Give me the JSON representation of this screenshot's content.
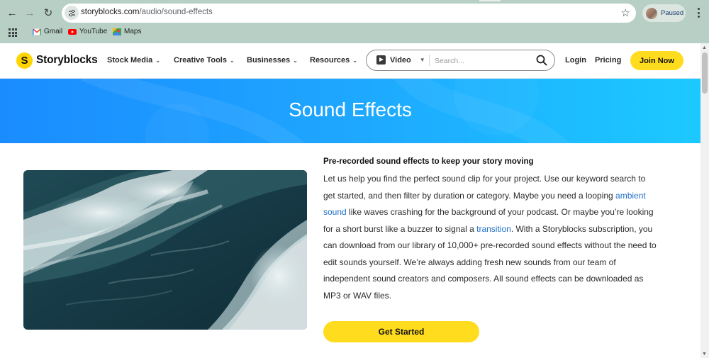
{
  "browser": {
    "url_host": "storyblocks.com",
    "url_path": "/audio/sound-effects",
    "profile_status": "Paused",
    "bookmarks": [
      {
        "label": "Gmail",
        "icon": "gmail-icon"
      },
      {
        "label": "YouTube",
        "icon": "youtube-icon"
      },
      {
        "label": "Maps",
        "icon": "maps-icon"
      }
    ]
  },
  "header": {
    "logo_mark": "S",
    "logo_text": "Storyblocks",
    "nav": [
      {
        "label": "Stock Media"
      },
      {
        "label": "Creative Tools"
      },
      {
        "label": "Businesses"
      },
      {
        "label": "Resources"
      }
    ],
    "search": {
      "type_label": "Video",
      "placeholder": "Search..."
    },
    "login_label": "Login",
    "pricing_label": "Pricing",
    "join_label": "Join Now",
    "colors": {
      "accent": "#ffdd1e",
      "hero_start": "#1a8cff",
      "hero_end": "#1cc9ff",
      "link": "#1f6fc9"
    }
  },
  "hero": {
    "title": "Sound Effects"
  },
  "intro": {
    "heading": "Pre-recorded sound effects to keep your story moving",
    "p1": "Let us help you find the perfect sound clip for your project. Use our keyword search to get started, and then filter by duration or category. Maybe you need a looping ",
    "link1": "ambient sound",
    "p2": " like waves crashing for the background of your podcast. Or maybe you’re looking for a short burst like a buzzer to signal a ",
    "link2": "transition",
    "p3": ". With a Storyblocks subscription, you can download from our library of 10,000+ pre-recorded sound effects without the need to edit sounds yourself. We’re always adding fresh new sounds from our team of independent sound creators and composers. All sound effects can be downloaded as MP3 or WAV files.",
    "cta_label": "Get Started"
  }
}
